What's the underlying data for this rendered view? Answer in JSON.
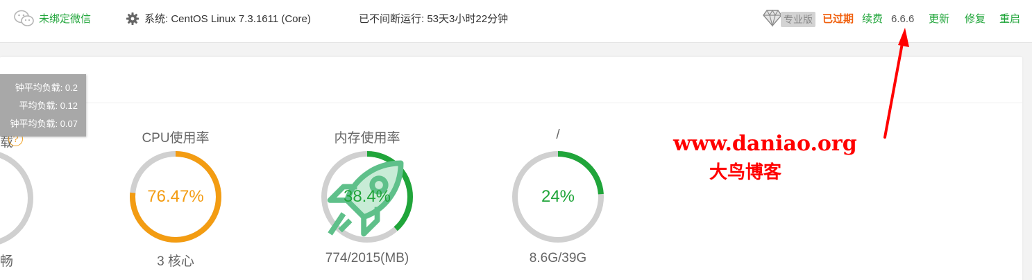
{
  "topbar": {
    "wechat_label": "未绑定微信",
    "system_label": "系统:  CentOS Linux 7.3.1611 (Core)",
    "uptime_label": "已不间断运行: 53天3小时22分钟",
    "pro_badge": "专业版",
    "expired_label": "已过期",
    "renew_label": "续费",
    "version": "6.6.6",
    "update_label": "更新",
    "repair_label": "修复",
    "restart_label": "重启"
  },
  "load_tooltip": {
    "line1": "钟平均负载:  0.2",
    "line2": "平均负载:  0.12",
    "line3": "钟平均负载:  0.07"
  },
  "load_partial": {
    "title_fragment": "载",
    "help": "?",
    "status_fragment": "畅"
  },
  "gauges": {
    "cpu": {
      "title": "CPU使用率",
      "value": "76.47%",
      "percent": 76.47,
      "sub": "3 核心",
      "color": "#f39c12"
    },
    "memory": {
      "title": "内存使用率",
      "value": "38.4%",
      "percent": 38.4,
      "sub": "774/2015(MB)",
      "color": "#20a53a"
    },
    "disk": {
      "title": "/",
      "value": "24%",
      "percent": 24,
      "sub": "8.6G/39G",
      "color": "#20a53a"
    }
  },
  "watermark": {
    "url": "www.daniao.org",
    "name": "大鸟博客"
  },
  "icons": {
    "wechat": "wechat-icon",
    "gear": "gear-icon",
    "diamond": "diamond-icon",
    "rocket": "rocket-icon"
  }
}
